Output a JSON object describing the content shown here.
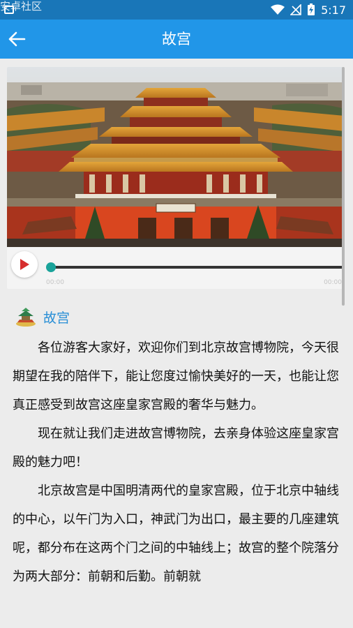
{
  "status_bar": {
    "watermark": "安卓社区",
    "time": "5:17"
  },
  "app_bar": {
    "back_icon": "arrow-left-icon",
    "title": "故宫"
  },
  "player": {
    "play_icon": "play-icon",
    "progress": 0.0,
    "current_time": "00:00",
    "total_time": "00:00"
  },
  "section": {
    "icon": "pavilion-icon",
    "name": "故宫"
  },
  "paragraphs": [
    "各位游客大家好，欢迎你们到北京故宫博物院，今天很期望在我的陪伴下，能让您度过愉快美好的一天，也能让您真正感受到故宫这座皇家宫殿的奢华与魅力。",
    "现在就让我们走进故宫博物院，去亲身体验这座皇家宫殿的魅力吧！",
    "北京故宫是中国明清两代的皇家宫殿，位于北京中轴线的中心，以午门为入口，神武门为出口，最主要的几座建筑呢，都分布在这两个门之间的中轴线上；故宫的整个院落分为两大部分：前朝和后勤。前朝就"
  ]
}
